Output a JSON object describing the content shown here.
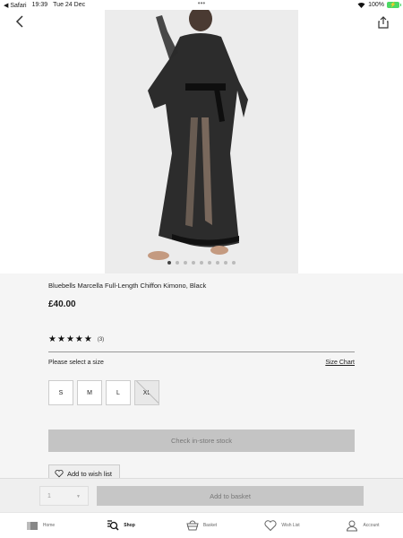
{
  "status_bar": {
    "app": "Safari",
    "time": "19:39",
    "date": "Tue 24 Dec",
    "battery": "100%",
    "multitask_dots": "•••"
  },
  "icons": {
    "back": "chevron-left-icon",
    "share": "share-icon",
    "wifi": "wifi-icon",
    "battery": "battery-icon",
    "star": "star-icon",
    "heart": "heart-icon"
  },
  "gallery": {
    "total": 9,
    "active_index": 0
  },
  "product": {
    "title": "Bluebells Marcella Full-Length Chiffon Kimono, Black",
    "price": "£40.00",
    "rating_stars": 5,
    "rating_count": "(3)"
  },
  "size": {
    "label": "Please select a size",
    "chart_link": "Size Chart",
    "options": [
      {
        "label": "S",
        "available": true
      },
      {
        "label": "M",
        "available": true
      },
      {
        "label": "L",
        "available": true
      },
      {
        "label": "XL",
        "available": false
      }
    ]
  },
  "actions": {
    "stock": "Check in-store stock",
    "wishlist": "Add to wish list",
    "quantity": "1",
    "basket": "Add to basket"
  },
  "tabs": [
    {
      "label": "Home",
      "icon": "home-icon"
    },
    {
      "label": "Shop",
      "icon": "shop-search-icon",
      "active": true
    },
    {
      "label": "Basket",
      "icon": "basket-icon"
    },
    {
      "label": "Wish List",
      "icon": "heart-icon"
    },
    {
      "label": "Account",
      "icon": "account-icon"
    }
  ],
  "colors": {
    "battery": "#4cd964",
    "disabled_button": "#c4c4c4"
  }
}
